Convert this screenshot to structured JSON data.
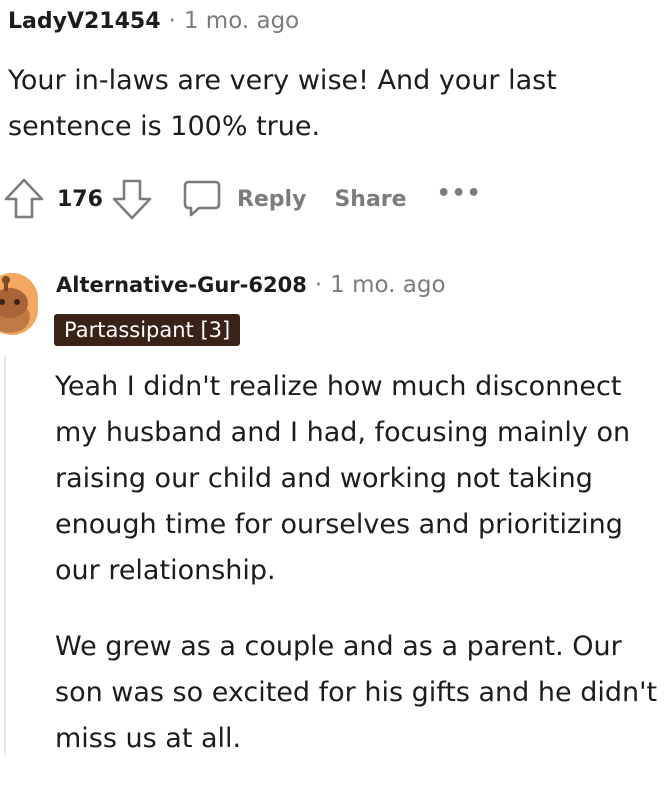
{
  "comment1": {
    "author": "LadyV21454",
    "separator": "·",
    "time": "1 mo. ago",
    "body": "Your in-laws are very wise! And your last sentence is 100% true.",
    "actions": {
      "vote_count": "176",
      "reply_label": "Reply",
      "share_label": "Share",
      "more_label": "•••"
    }
  },
  "comment2": {
    "author": "Alternative-Gur-6208",
    "separator": "·",
    "time": "1 mo. ago",
    "flair": "Partassipant [3]",
    "paragraphs": [
      "Yeah I didn't realize how much disconnect my husband and I had, focusing mainly on raising our child and working not taking enough time for ourselves and prioritizing our relationship.",
      "We grew as a couple and as a parent. Our son was so excited for his gifts and he didn't miss us at all."
    ]
  },
  "icons": {
    "upvote": "upvote-arrow-icon",
    "downvote": "downvote-arrow-icon",
    "reply": "speech-bubble-icon",
    "more": "ellipsis-icon",
    "avatar": "snoo-avatar-icon"
  },
  "colors": {
    "text": "#1c1c1c",
    "meta": "#7c7c7c",
    "flair_bg": "#3a2316",
    "avatar_bg": "#f4a760"
  }
}
